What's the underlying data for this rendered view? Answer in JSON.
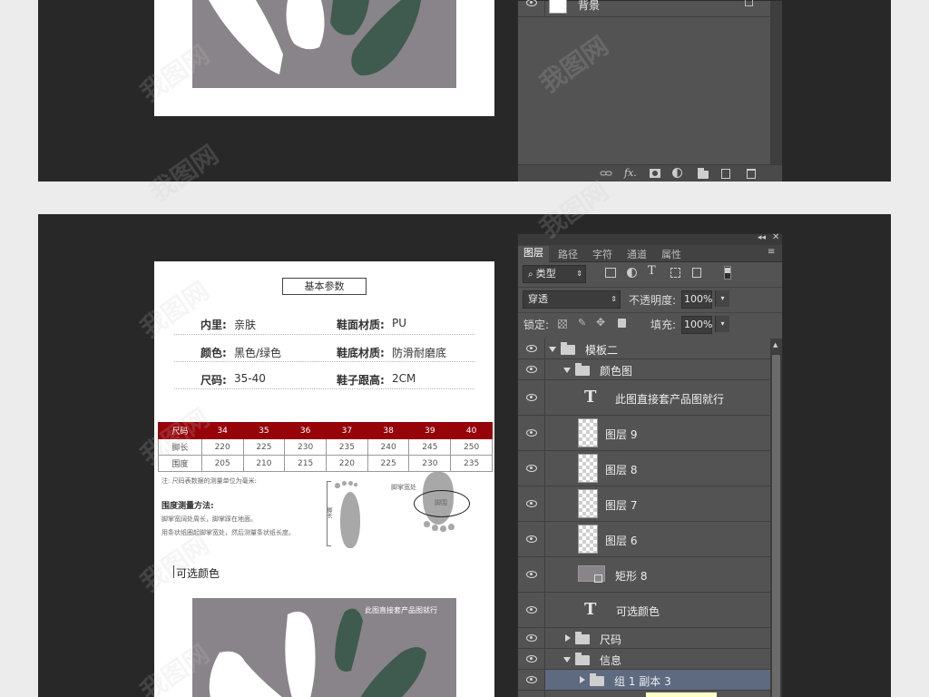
{
  "top_section": {
    "layer_name": "背景",
    "footer_icons": [
      "link-icon",
      "fx-icon",
      "mask-icon",
      "adjustment-icon",
      "folder-icon",
      "new-layer-icon",
      "trash-icon"
    ],
    "footer_fx": "fx."
  },
  "panel": {
    "tabs": [
      {
        "label": "图层",
        "active": true
      },
      {
        "label": "路径",
        "active": false
      },
      {
        "label": "字符",
        "active": false
      },
      {
        "label": "通道",
        "active": false
      },
      {
        "label": "属性",
        "active": false
      }
    ],
    "filter_kind": "类型",
    "blend_mode": "穿透",
    "opacity_label": "不透明度:",
    "opacity_value": "100%",
    "lock_label": "锁定:",
    "fill_label": "填充:",
    "fill_value": "100%",
    "layers": [
      {
        "name": "模板二",
        "type": "group",
        "expanded": true,
        "indent": 0,
        "selected": false
      },
      {
        "name": "颜色图",
        "type": "group",
        "expanded": true,
        "indent": 1,
        "selected": false
      },
      {
        "name": "此图直接套产品图就行",
        "type": "text",
        "indent": 2,
        "selected": false
      },
      {
        "name": "图层 9",
        "type": "pixel",
        "indent": 2,
        "selected": false
      },
      {
        "name": "图层 8",
        "type": "pixel",
        "indent": 2,
        "selected": false
      },
      {
        "name": "图层 7",
        "type": "pixel",
        "indent": 2,
        "selected": false
      },
      {
        "name": "图层 6",
        "type": "pixel",
        "indent": 2,
        "selected": false
      },
      {
        "name": "矩形 8",
        "type": "shape",
        "indent": 2,
        "selected": false
      },
      {
        "name": "可选颜色",
        "type": "text",
        "indent": 2,
        "selected": false
      },
      {
        "name": "尺码",
        "type": "group",
        "expanded": false,
        "indent": 1,
        "selected": false
      },
      {
        "name": "信息",
        "type": "group",
        "expanded": true,
        "indent": 1,
        "selected": false
      },
      {
        "name": "组 1 副本 3",
        "type": "group",
        "expanded": false,
        "indent": 2,
        "selected": true
      }
    ]
  },
  "document": {
    "heading": "基本参数",
    "specs": [
      {
        "label": "内里:",
        "value": "亲肤"
      },
      {
        "label": "鞋面材质:",
        "value": "PU"
      },
      {
        "label": "颜色:",
        "value": "黑色/绿色"
      },
      {
        "label": "鞋底材质:",
        "value": "防滑耐磨底"
      },
      {
        "label": "尺码:",
        "value": "35-40"
      },
      {
        "label": "鞋子跟高:",
        "value": "2CM"
      }
    ],
    "size_table": {
      "header": [
        "尺码",
        "34",
        "35",
        "36",
        "37",
        "38",
        "39",
        "40"
      ],
      "rows": [
        [
          "脚长",
          "220",
          "225",
          "230",
          "235",
          "240",
          "245",
          "250"
        ],
        [
          "围度",
          "205",
          "210",
          "215",
          "220",
          "225",
          "230",
          "235"
        ]
      ]
    },
    "note": "注: 尺码表数据的测量单位为毫米:",
    "method_title": "围度测量方法:",
    "method_lines": [
      "脚掌宽阔处周长，脚掌踩在地面。",
      "用条状纸圈起脚掌宽处，然后测量条状纸长度。"
    ],
    "foot_length_label": "脚长",
    "foot_widest_label": "脚掌宽处",
    "girth_label": "脚围",
    "optional_colors": "可选颜色",
    "product_caption": "此图直接套产品图就行"
  },
  "watermark_text": "我图网",
  "colors": {
    "workarea": "#282828",
    "panel": "#535353",
    "table_header": "#96040a",
    "selected_row": "#5d6a80",
    "product_bg": "#898489",
    "shoe_green": "#3f5b4f"
  }
}
